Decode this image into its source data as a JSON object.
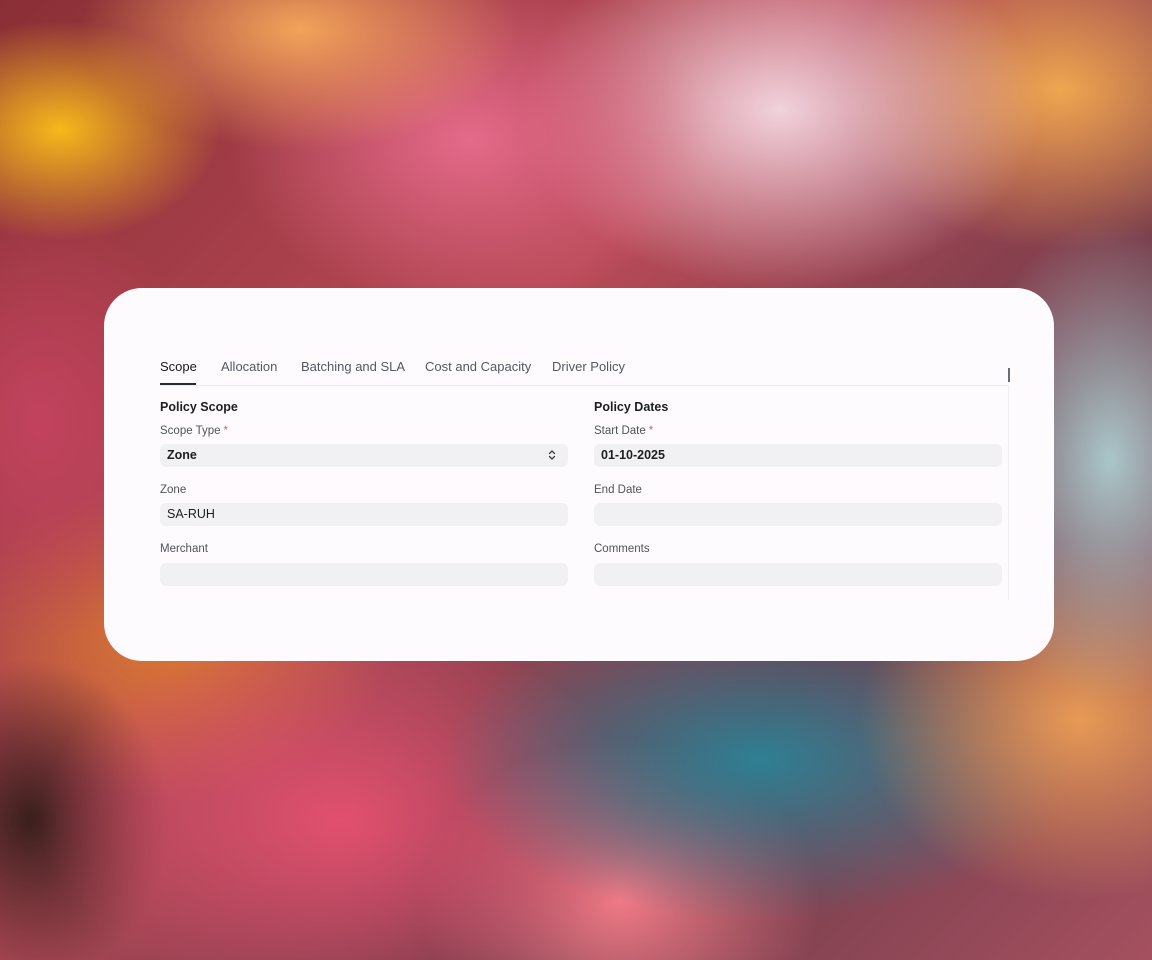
{
  "tabs": [
    {
      "label": "Scope",
      "active": true
    },
    {
      "label": "Allocation",
      "active": false
    },
    {
      "label": "Batching and SLA",
      "active": false
    },
    {
      "label": "Cost and Capacity",
      "active": false
    },
    {
      "label": "Driver Policy",
      "active": false
    }
  ],
  "policy_scope": {
    "title": "Policy Scope",
    "scope_type": {
      "label": "Scope Type",
      "required_marker": "*",
      "value": "Zone"
    },
    "zone": {
      "label": "Zone",
      "value": "SA-RUH"
    },
    "merchant": {
      "label": "Merchant",
      "value": ""
    }
  },
  "policy_dates": {
    "title": "Policy Dates",
    "start_date": {
      "label": "Start Date",
      "required_marker": "*",
      "value": "01-10-2025"
    },
    "end_date": {
      "label": "End Date",
      "value": ""
    },
    "comments": {
      "label": "Comments",
      "value": ""
    }
  },
  "colors": {
    "required": "#e05a6c",
    "field_bg": "#f1f1f4",
    "card_bg": "#fdfbfd"
  },
  "icons": {
    "scope_type_select": "chevron-up-down-icon"
  }
}
